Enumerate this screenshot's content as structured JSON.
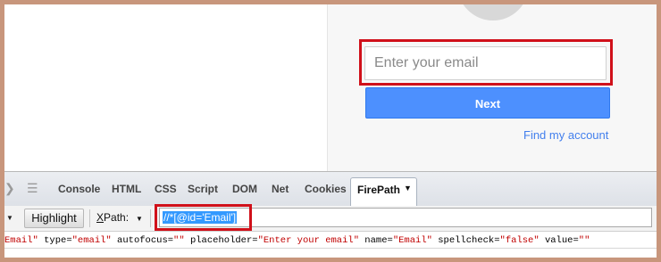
{
  "login": {
    "email_placeholder": "Enter your email",
    "next_label": "Next",
    "find_account_label": "Find my account"
  },
  "devtools": {
    "tabs": [
      "Console",
      "HTML",
      "CSS",
      "Script",
      "DOM",
      "Net",
      "Cookies"
    ],
    "active_tab": "FirePath",
    "toolbar": {
      "highlight_label": "Highlight",
      "xpath_prefix": "X",
      "xpath_rest": "Path:",
      "xpath_value": "//*[@id='Email']"
    },
    "source_line": {
      "start": "Email\"",
      "type_attr": " type=",
      "type_val": "\"email\"",
      "autofocus_attr": " autofocus=",
      "autofocus_val": "\"\"",
      "placeholder_attr": " placeholder=",
      "placeholder_val": "\"Enter your email\"",
      "name_attr": " name=",
      "name_val": "\"Email\"",
      "spellcheck_attr": " spellcheck=",
      "spellcheck_val": "\"false\"",
      "value_attr": " value=",
      "value_val": "\"\""
    }
  },
  "colors": {
    "highlight_border": "#d0101a",
    "next_button": "#4d90fe",
    "link": "#427fed",
    "selection": "#3399ff"
  }
}
